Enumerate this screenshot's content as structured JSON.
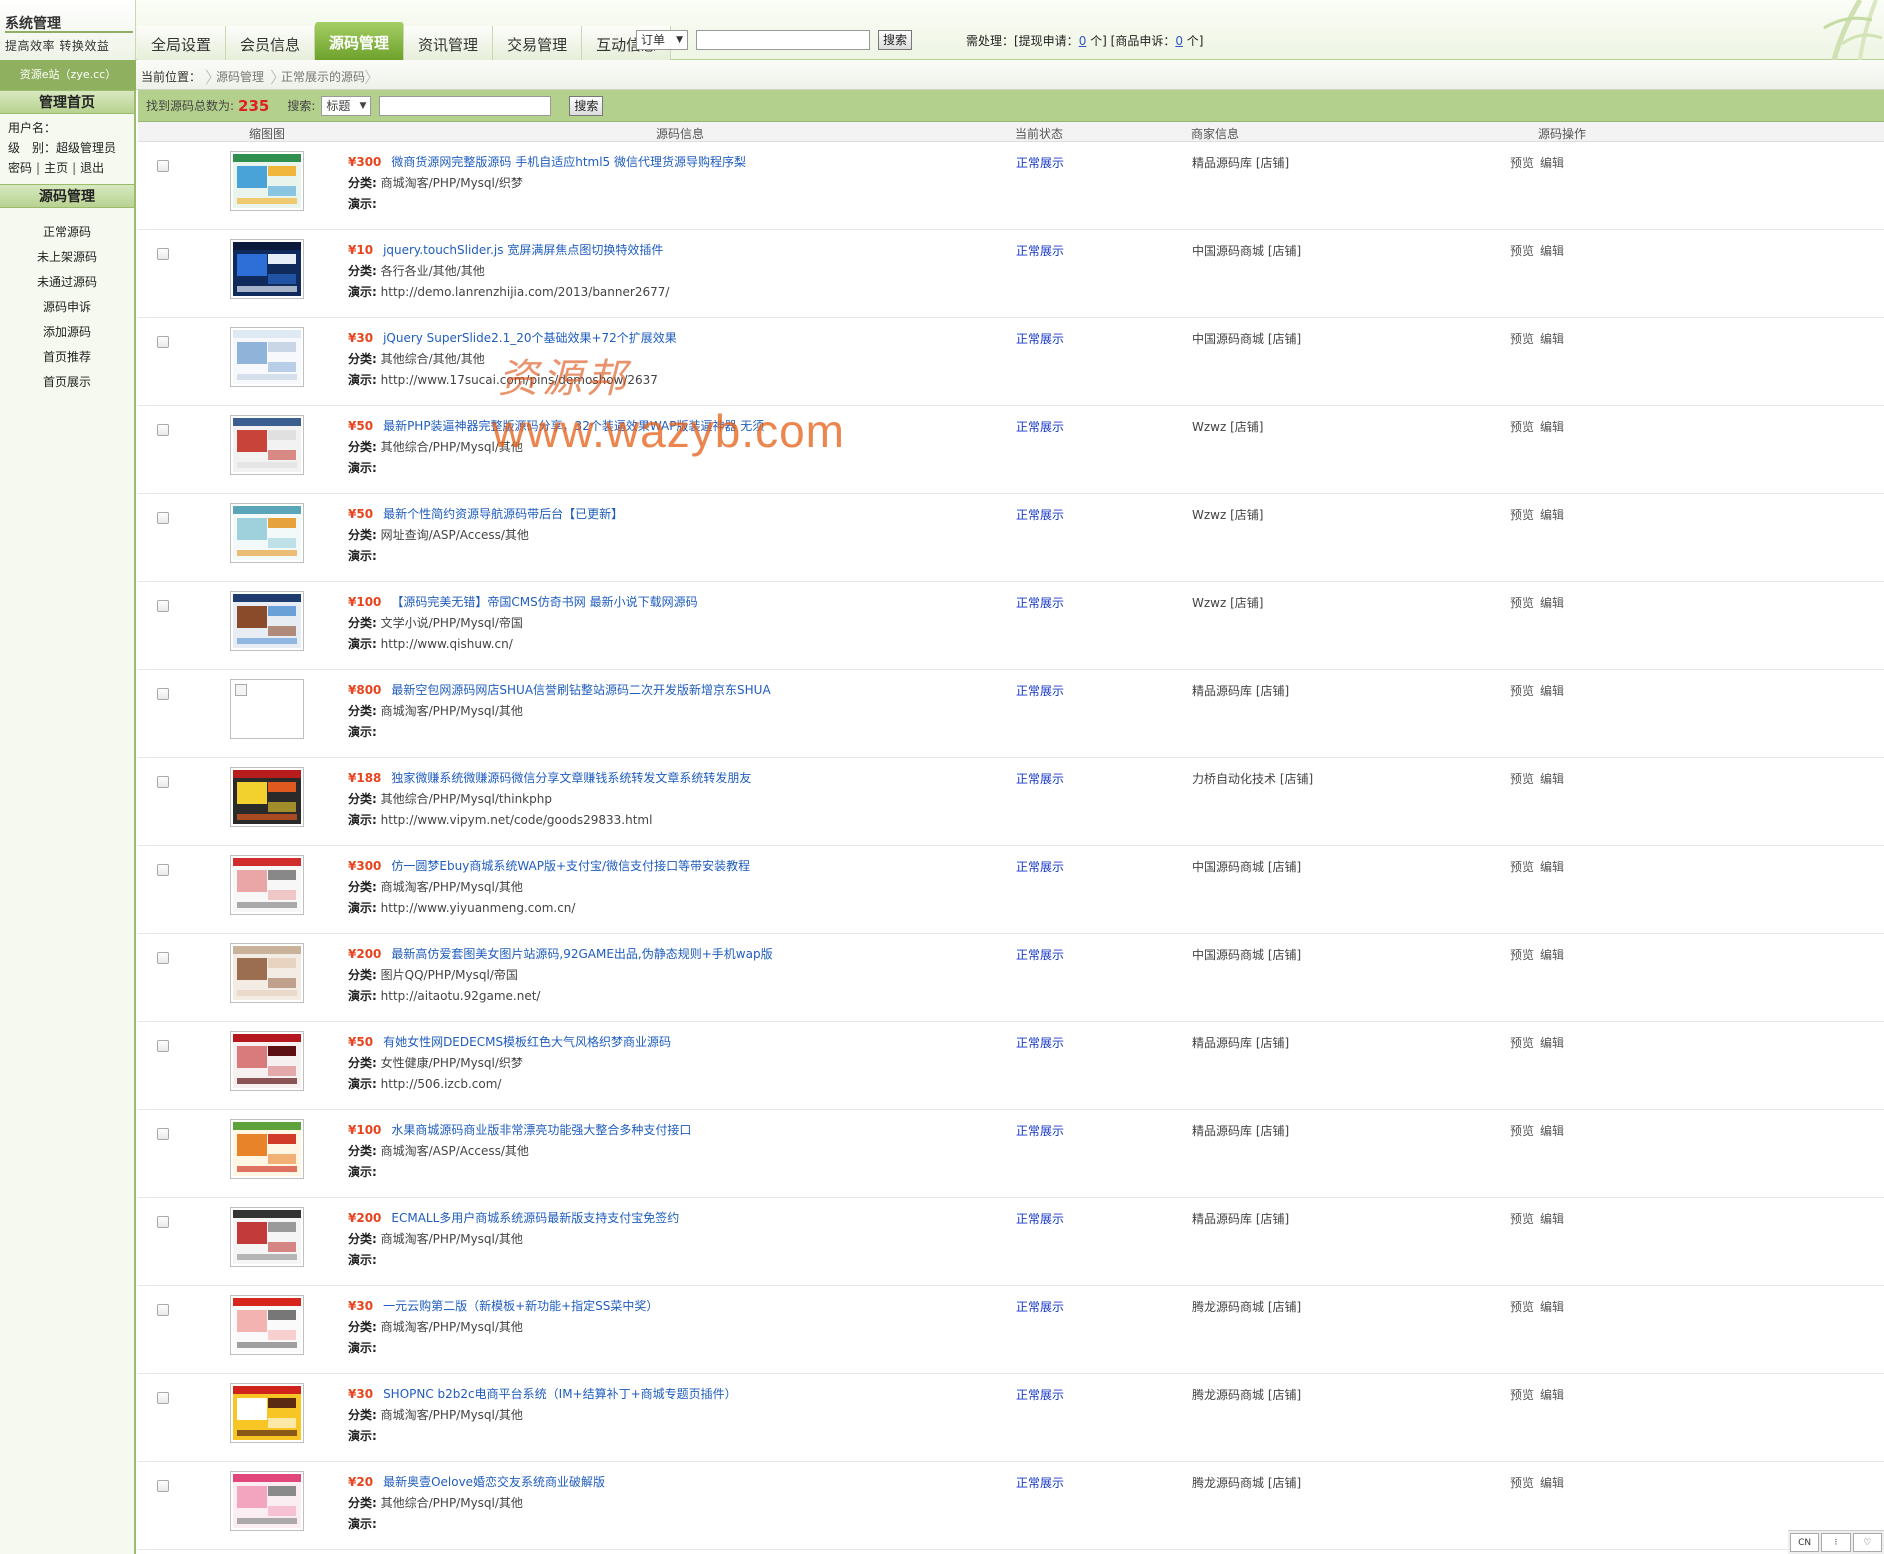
{
  "brand": {
    "title": "系统管理",
    "subtitle": "提高效率  转换效益"
  },
  "nav": {
    "tabs": [
      {
        "label": "全局设置"
      },
      {
        "label": "会员信息"
      },
      {
        "label": "源码管理",
        "active": true
      },
      {
        "label": "资讯管理"
      },
      {
        "label": "交易管理"
      },
      {
        "label": "互动信息"
      }
    ]
  },
  "quick_search": {
    "select_value": "订单",
    "input_value": "",
    "button_label": "搜索"
  },
  "pending": {
    "prefix": "需处理：[提现申请：",
    "withdraw_count": "0",
    "middle": " 个] [商品申诉：",
    "appeal_count": "0",
    "suffix": " 个]"
  },
  "site_badge": "资源e站（zye.cc）",
  "breadcrumb": {
    "label": "当前位置：",
    "items": [
      "源码管理",
      "正常展示的源码"
    ]
  },
  "sidebar": {
    "home_label": "管理首页",
    "user": {
      "username_label": "用户名：",
      "username": "",
      "level_label": "级　别：",
      "level": "超级管理员",
      "links": [
        "密码",
        "主页",
        "退出"
      ]
    },
    "section_label": "源码管理",
    "menu": [
      "正常源码",
      "未上架源码",
      "未通过源码",
      "源码申诉",
      "添加源码",
      "首页推荐",
      "首页展示"
    ]
  },
  "filter": {
    "total_label": "找到源码总数为:",
    "total_count": "235",
    "search_label": "搜索:",
    "select_value": "标题",
    "input_value": "",
    "button_label": "搜索"
  },
  "table": {
    "headers": [
      "缩图图",
      "源码信息",
      "当前状态",
      "商家信息",
      "源码操作"
    ],
    "category_label": "分类:",
    "demo_label": "演示:",
    "ops": [
      "预览",
      "编辑"
    ],
    "rows": [
      {
        "price": "¥300",
        "title": "微商货源网完整版源码 手机自适应html5 微信代理货源导购程序梨",
        "category": "商城淘客/PHP/Mysql/织梦",
        "demo": "",
        "status": "正常展示",
        "merchant": "精品源码库 [店铺]",
        "thumb": "grid"
      },
      {
        "price": "¥10",
        "title": "jquery.touchSlider.js 宽屏满屏焦点图切换特效插件",
        "category": "各行各业/其他/其他",
        "demo": "http://demo.lanrenzhijia.com/2013/banner2677/",
        "status": "正常展示",
        "merchant": "中国源码商城 [店铺]",
        "thumb": "dark"
      },
      {
        "price": "¥30",
        "title": "jQuery SuperSlide2.1_20个基础效果+72个扩展效果",
        "category": "其他综合/其他/其他",
        "demo": "http://www.17sucai.com/pins/demoshow/2637",
        "status": "正常展示",
        "merchant": "中国源码商城 [店铺]",
        "thumb": "light"
      },
      {
        "price": "¥50",
        "title": "最新PHP装逼神器完整版源码分享，32个装逼效果WAP版装逼神器 无须",
        "category": "其他综合/PHP/Mysql/其他",
        "demo": "",
        "status": "正常展示",
        "merchant": "Wzwz [店铺]",
        "thumb": "list"
      },
      {
        "price": "¥50",
        "title": "最新个性简约资源导航源码带后台【已更新】",
        "category": "网址查询/ASP/Access/其他",
        "demo": "",
        "status": "正常展示",
        "merchant": "Wzwz [店铺]",
        "thumb": "nav"
      },
      {
        "price": "¥100",
        "title": "【源码完美无错】帝国CMS仿奇书网 最新小说下载网源码",
        "category": "文学小说/PHP/Mysql/帝国",
        "demo": "http://www.qishuw.cn/",
        "status": "正常展示",
        "merchant": "Wzwz [店铺]",
        "thumb": "books"
      },
      {
        "price": "¥800",
        "title": "最新空包网源码网店SHUA信誉刷钻整站源码二次开发版新增京东SHUA",
        "category": "商城淘客/PHP/Mysql/其他",
        "demo": "",
        "status": "正常展示",
        "merchant": "精品源码库 [店铺]",
        "thumb": "broken"
      },
      {
        "price": "¥188",
        "title": "独家微赚系统微赚源码微信分享文章赚钱系统转发文章系统转发朋友",
        "category": "其他综合/PHP/Mysql/thinkphp",
        "demo": "http://www.vipym.net/code/goods29833.html",
        "status": "正常展示",
        "merchant": "力桥自动化技术 [店铺]",
        "thumb": "red"
      },
      {
        "price": "¥300",
        "title": "仿一圆梦Ebuy商城系统WAP版+支付宝/微信支付接口等带安装教程",
        "category": "商城淘客/PHP/Mysql/其他",
        "demo": "http://www.yiyuanmeng.com.cn/",
        "status": "正常展示",
        "merchant": "中国源码商城 [店铺]",
        "thumb": "shop"
      },
      {
        "price": "¥200",
        "title": "最新高仿爱套图美女图片站源码,92GAME出品,伪静态规则+手机wap版",
        "category": "图片QQ/PHP/Mysql/帝国",
        "demo": "http://aitaotu.92game.net/",
        "status": "正常展示",
        "merchant": "中国源码商城 [店铺]",
        "thumb": "photo"
      },
      {
        "price": "¥50",
        "title": "有她女性网DEDECMS模板红色大气风格织梦商业源码",
        "category": "女性健康/PHP/Mysql/织梦",
        "demo": "http://506.izcb.com/",
        "status": "正常展示",
        "merchant": "精品源码库 [店铺]",
        "thumb": "woman"
      },
      {
        "price": "¥100",
        "title": "水果商城源码商业版非常漂亮功能强大整合多种支付接口",
        "category": "商城淘客/ASP/Access/其他",
        "demo": "",
        "status": "正常展示",
        "merchant": "精品源码库 [店铺]",
        "thumb": "fruit"
      },
      {
        "price": "¥200",
        "title": "ECMALL多用户商城系统源码最新版支持支付宝免签约",
        "category": "商城淘客/PHP/Mysql/其他",
        "demo": "",
        "status": "正常展示",
        "merchant": "精品源码库 [店铺]",
        "thumb": "mall"
      },
      {
        "price": "¥30",
        "title": "一元云购第二版（新模板+新功能+指定SS菜中奖）",
        "category": "商城淘客/PHP/Mysql/其他",
        "demo": "",
        "status": "正常展示",
        "merchant": "腾龙源码商城 [店铺]",
        "thumb": "yuan"
      },
      {
        "price": "¥30",
        "title": "SHOPNC b2b2c电商平台系统（IM+结算补丁+商城专题页插件）",
        "category": "商城淘客/PHP/Mysql/其他",
        "demo": "",
        "status": "正常展示",
        "merchant": "腾龙源码商城 [店铺]",
        "thumb": "promo"
      },
      {
        "price": "¥20",
        "title": "最新奥壹Oelove婚恋交友系统商业破解版",
        "category": "其他综合/PHP/Mysql/其他",
        "demo": "",
        "status": "正常展示",
        "merchant": "腾龙源码商城 [店铺]",
        "thumb": "love"
      }
    ]
  },
  "watermark": {
    "cn": "资源邦",
    "en": "www.wazyb.com"
  },
  "tray": [
    "CN",
    "⁝",
    "♡"
  ],
  "colors": {
    "accent_green": "#8fb05f",
    "filter_bar": "#b3d18c",
    "price_red": "#e8431d",
    "title_blue": "#1f5dbf",
    "status_blue": "#1737c8"
  }
}
